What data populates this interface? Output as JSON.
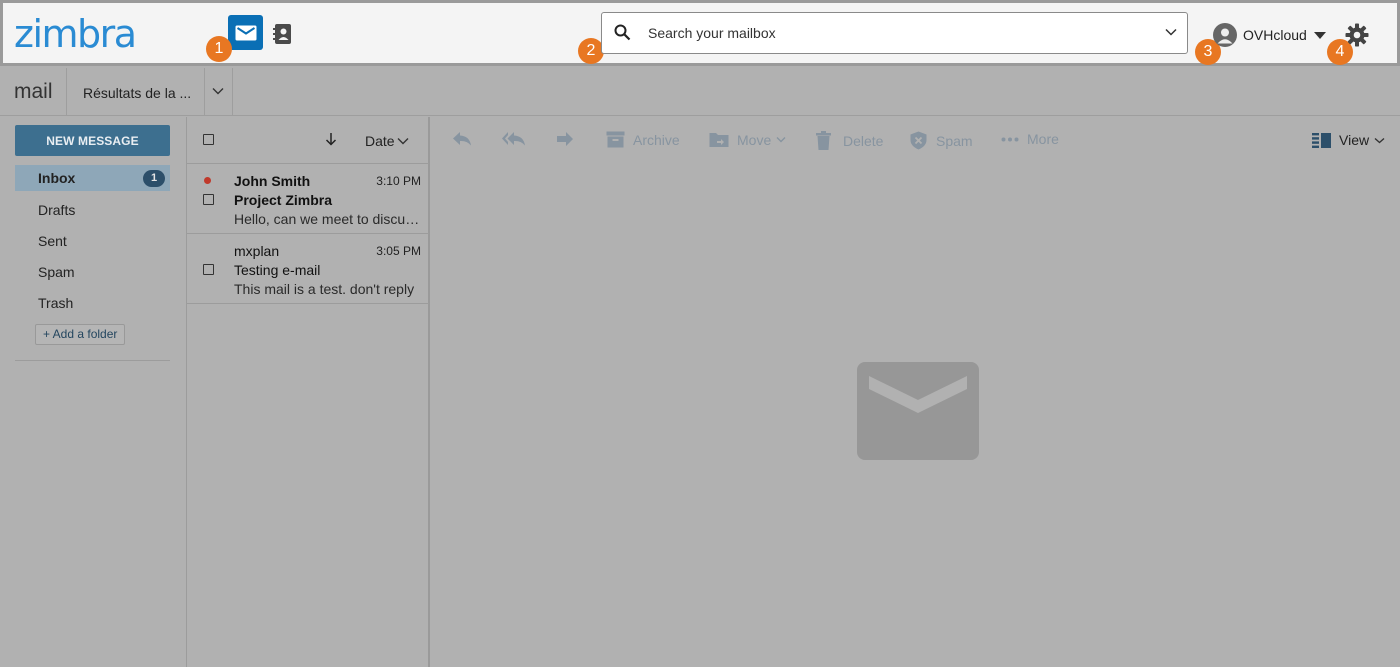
{
  "header": {
    "logo": "zimbra",
    "apps": [
      {
        "name": "mail",
        "icon": "mail-icon",
        "active": true
      },
      {
        "name": "contacts",
        "icon": "contacts-icon",
        "active": false
      }
    ],
    "search": {
      "placeholder": "Search your mailbox",
      "value": ""
    },
    "account": {
      "name": "OVHcloud"
    },
    "callouts": [
      "1",
      "2",
      "3",
      "4"
    ]
  },
  "subbar": {
    "app_name": "mail",
    "tab_label": "Résultats de la ..."
  },
  "sidebar": {
    "new_message": "NEW MESSAGE",
    "folders": [
      {
        "label": "Inbox",
        "count": "1",
        "active": true
      },
      {
        "label": "Drafts"
      },
      {
        "label": "Sent"
      },
      {
        "label": "Spam"
      },
      {
        "label": "Trash"
      }
    ],
    "add_folder": "+ Add a folder"
  },
  "message_list": {
    "sort_label": "Date",
    "messages": [
      {
        "from": "John Smith",
        "time": "3:10 PM",
        "subject": "Project Zimbra",
        "preview": "Hello, can we meet to discuss...",
        "unread": true
      },
      {
        "from": "mxplan",
        "time": "3:05 PM",
        "subject": "Testing e-mail",
        "preview": "This mail is a test. don't reply",
        "unread": false
      }
    ]
  },
  "toolbar": {
    "reply": "reply-icon",
    "reply_all": "reply-all-icon",
    "forward": "forward-icon",
    "archive": "Archive",
    "move": "Move",
    "delete": "Delete",
    "spam": "Spam",
    "more": "More",
    "view": "View"
  },
  "colors": {
    "accent": "#0a6fb5",
    "logo": "#2a8bd3",
    "callout": "#e87722",
    "unread_dot": "#c0392b",
    "overlay": "#b1b1b1"
  }
}
